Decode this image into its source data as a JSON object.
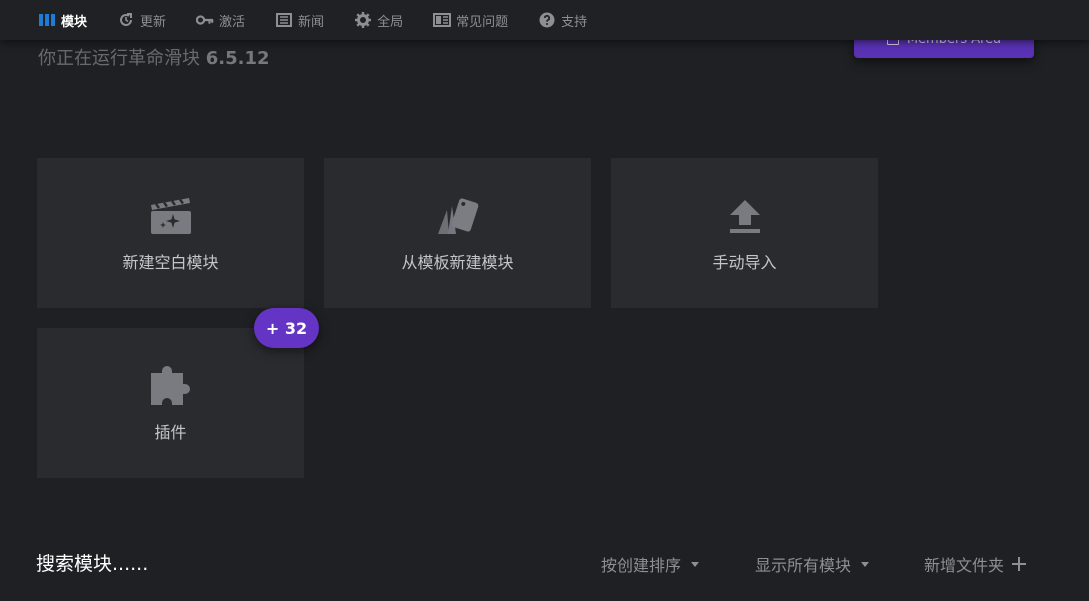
{
  "nav": {
    "items": [
      {
        "label": "模块",
        "icon": "modules-icon",
        "active": true
      },
      {
        "label": "更新",
        "icon": "update-icon"
      },
      {
        "label": "激活",
        "icon": "key-icon"
      },
      {
        "label": "新闻",
        "icon": "news-icon"
      },
      {
        "label": "全局",
        "icon": "gear-icon"
      },
      {
        "label": "常见问题",
        "icon": "faq-icon"
      },
      {
        "label": "支持",
        "icon": "help-icon"
      }
    ]
  },
  "header": {
    "members_label": "Members Area",
    "version_text": "你正在运行革命滑块",
    "version_number": "6.5.12"
  },
  "cards": [
    {
      "label": "新建空白模块",
      "icon": "clapper-sparkle-icon"
    },
    {
      "label": "从模板新建模块",
      "icon": "template-cards-icon"
    },
    {
      "label": "手动导入",
      "icon": "upload-icon"
    },
    {
      "label": "插件",
      "icon": "puzzle-icon"
    }
  ],
  "badge": {
    "text": "+ 32"
  },
  "bottom": {
    "search_placeholder": "搜索模块......",
    "sort_label": "按创建排序",
    "filter_label": "显示所有模块",
    "new_folder_label": "新增文件夹"
  },
  "colors": {
    "background": "#1f2023",
    "card": "#2a2b2f",
    "accent": "#6434c4",
    "active_nav_icon": "#1e7bd6"
  }
}
